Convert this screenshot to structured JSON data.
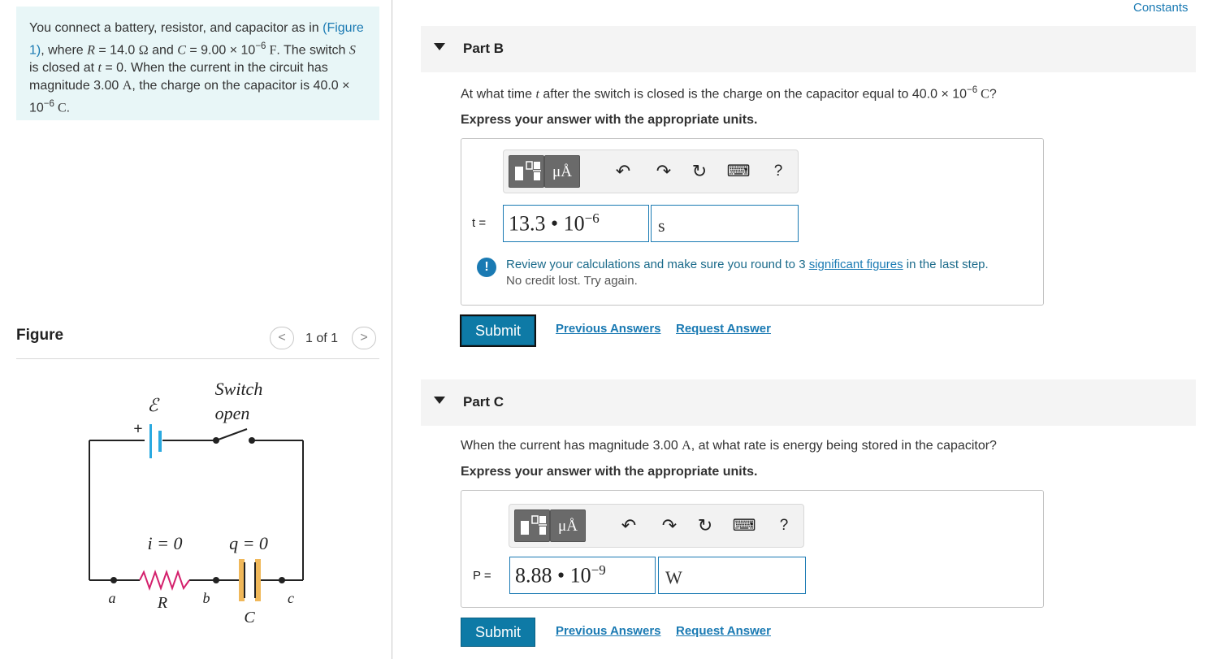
{
  "problem": {
    "segments": [
      {
        "t": "You connect a battery, resistor, and capacitor as in ",
        "c": ""
      },
      {
        "t": "(Figure 1)",
        "c": "link"
      },
      {
        "t": ", where ",
        "c": ""
      },
      {
        "t": "R",
        "c": "it"
      },
      {
        "t": " = 14.0 ",
        "c": ""
      },
      {
        "t": "Ω",
        "c": "ser"
      },
      {
        "t": " and ",
        "c": ""
      },
      {
        "t": "C",
        "c": "it"
      },
      {
        "t": " = 9.00 × 10",
        "c": ""
      },
      {
        "t": "−6",
        "c": "sup"
      },
      {
        "t": " F",
        "c": "ser"
      },
      {
        "t": ". The switch ",
        "c": ""
      },
      {
        "t": "S",
        "c": "it"
      },
      {
        "t": " is closed at ",
        "c": ""
      },
      {
        "t": "t",
        "c": "it"
      },
      {
        "t": " = 0. When the current in the circuit has magnitude 3.00 ",
        "c": ""
      },
      {
        "t": "A",
        "c": "ser"
      },
      {
        "t": ", the charge on the capacitor is 40.0 × 10",
        "c": ""
      },
      {
        "t": "−6",
        "c": "sup"
      },
      {
        "t": " C",
        "c": "ser"
      },
      {
        "t": ".",
        "c": ""
      }
    ]
  },
  "figure": {
    "title": "Figure",
    "prev": "<",
    "next": ">",
    "count": "1 of 1",
    "labels": {
      "emf": "ℰ",
      "plus": "+",
      "switch": "Switch",
      "open": "open",
      "current": "i = 0",
      "charge": "q = 0",
      "a": "a",
      "b": "b",
      "c": "c",
      "R": "R",
      "C": "C"
    }
  },
  "header": {
    "constants": "Constants"
  },
  "toolbar": {
    "units": "μÅ",
    "undo": "↶",
    "redo": "↷",
    "reset": "↻",
    "keyboard": "⌨",
    "help": "?"
  },
  "partB": {
    "label": "Part B",
    "question": [
      {
        "t": "At what time ",
        "c": ""
      },
      {
        "t": "t",
        "c": "it"
      },
      {
        "t": " after the switch is closed is the charge on the capacitor equal to 40.0 × 10",
        "c": ""
      },
      {
        "t": "−6",
        "c": "sup"
      },
      {
        "t": " C",
        "c": "ser"
      },
      {
        "t": "?",
        "c": ""
      }
    ],
    "instruction": "Express your answer with the appropriate units.",
    "var": "t =",
    "value_mantissa": "13.3 • 10",
    "value_exp": "−6",
    "unit": "s",
    "feedback_icon": "!",
    "feedback_pre": "Review your calculations and make sure you round to 3 ",
    "feedback_link": "significant figures",
    "feedback_post": " in the last step.",
    "feedback_sub": "No credit lost. Try again.",
    "submit": "Submit",
    "previous": "Previous Answers",
    "request": "Request Answer"
  },
  "partC": {
    "label": "Part C",
    "question": [
      {
        "t": "When the current has magnitude 3.00 ",
        "c": ""
      },
      {
        "t": "A",
        "c": "ser"
      },
      {
        "t": ", at what rate is energy being stored in the capacitor?",
        "c": ""
      }
    ],
    "instruction": "Express your answer with the appropriate units.",
    "var": "P =",
    "value_mantissa": "8.88 • 10",
    "value_exp": "−9",
    "unit": "W",
    "submit": "Submit",
    "previous": "Previous Answers",
    "request": "Request Answer"
  },
  "colors": {
    "problem_bg": "#e8f6f7",
    "link": "#1a7ab3",
    "submit": "#0e7aa6",
    "battery": "#2aa9e0",
    "capacitor": "#f0b85a",
    "resistor": "#d4206c"
  }
}
